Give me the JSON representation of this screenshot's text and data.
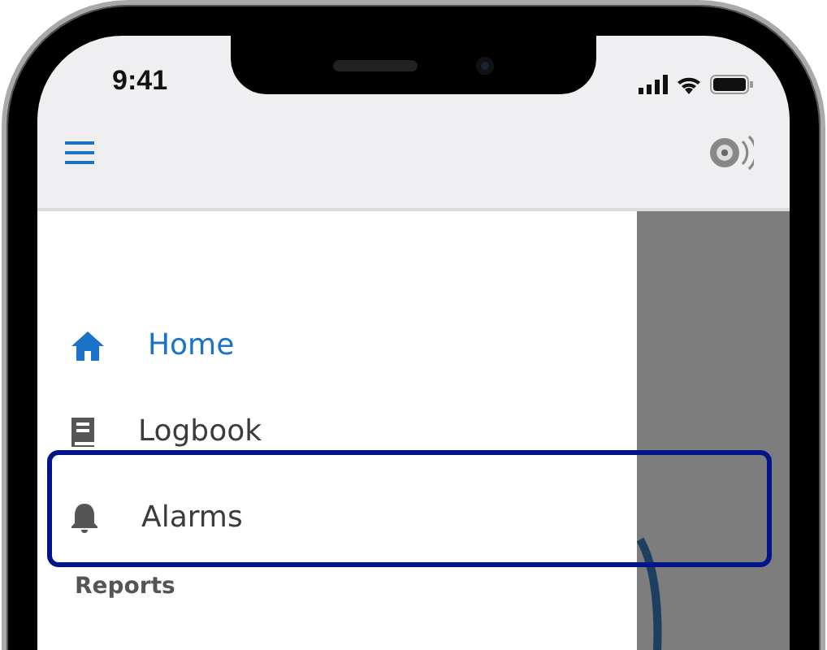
{
  "status_bar": {
    "time": "9:41"
  },
  "drawer": {
    "items": [
      {
        "label": "Home",
        "selected": true
      },
      {
        "label": "Logbook",
        "selected": false
      },
      {
        "label": "Alarms",
        "selected": false
      }
    ],
    "section": "Reports"
  }
}
